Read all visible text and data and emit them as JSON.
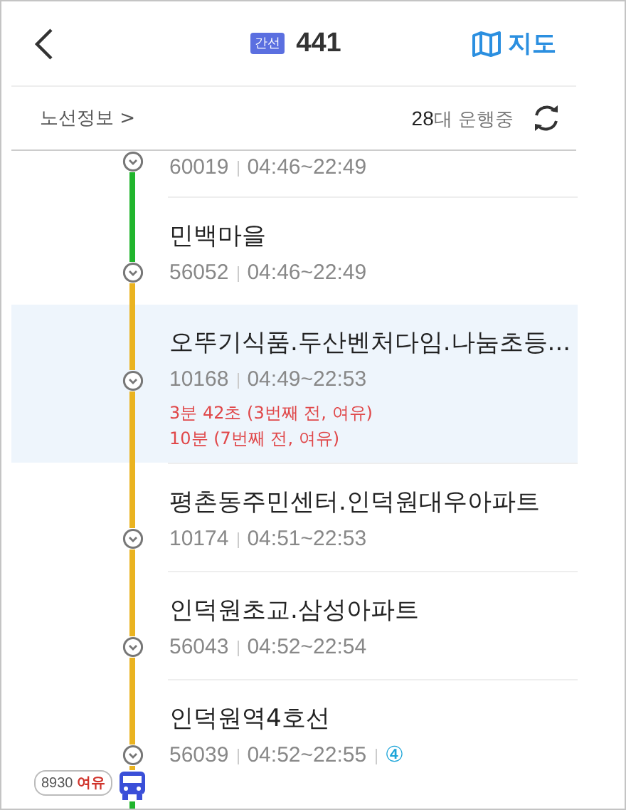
{
  "header": {
    "route_type": "간선",
    "route_number": "441",
    "map_button": "지도"
  },
  "subheader": {
    "route_info_link": "노선정보 >",
    "bus_count": "28",
    "bus_count_suffix": "대 운행중"
  },
  "stops": [
    {
      "id": "60019",
      "hours": "04:46~22:49",
      "color": "#21b52d",
      "selected": false
    },
    {
      "name": "민백마을",
      "id": "56052",
      "hours": "04:46~22:49",
      "color": "#eab320",
      "selected": false
    },
    {
      "name": "오뚜기식품.두산벤처다임.나눔초등...",
      "id": "10168",
      "hours": "04:49~22:53",
      "color": "#eab320",
      "selected": true,
      "arrivals": [
        "3분 42초 (3번째 전, 여유)",
        "10분 (7번째 전, 여유)"
      ]
    },
    {
      "name": "평촌동주민센터.인덕원대우아파트",
      "id": "10174",
      "hours": "04:51~22:53",
      "color": "#eab320",
      "selected": false
    },
    {
      "name": "인덕원초교.삼성아파트",
      "id": "56043",
      "hours": "04:52~22:54",
      "color": "#eab320",
      "selected": false
    },
    {
      "name": "인덕원역4호선",
      "id": "56039",
      "hours": "04:52~22:55",
      "color": "#eab320",
      "selected": false,
      "transfer": "④",
      "bus": {
        "plate": "8930",
        "status": "여유",
        "color": "#21b52d"
      }
    }
  ]
}
